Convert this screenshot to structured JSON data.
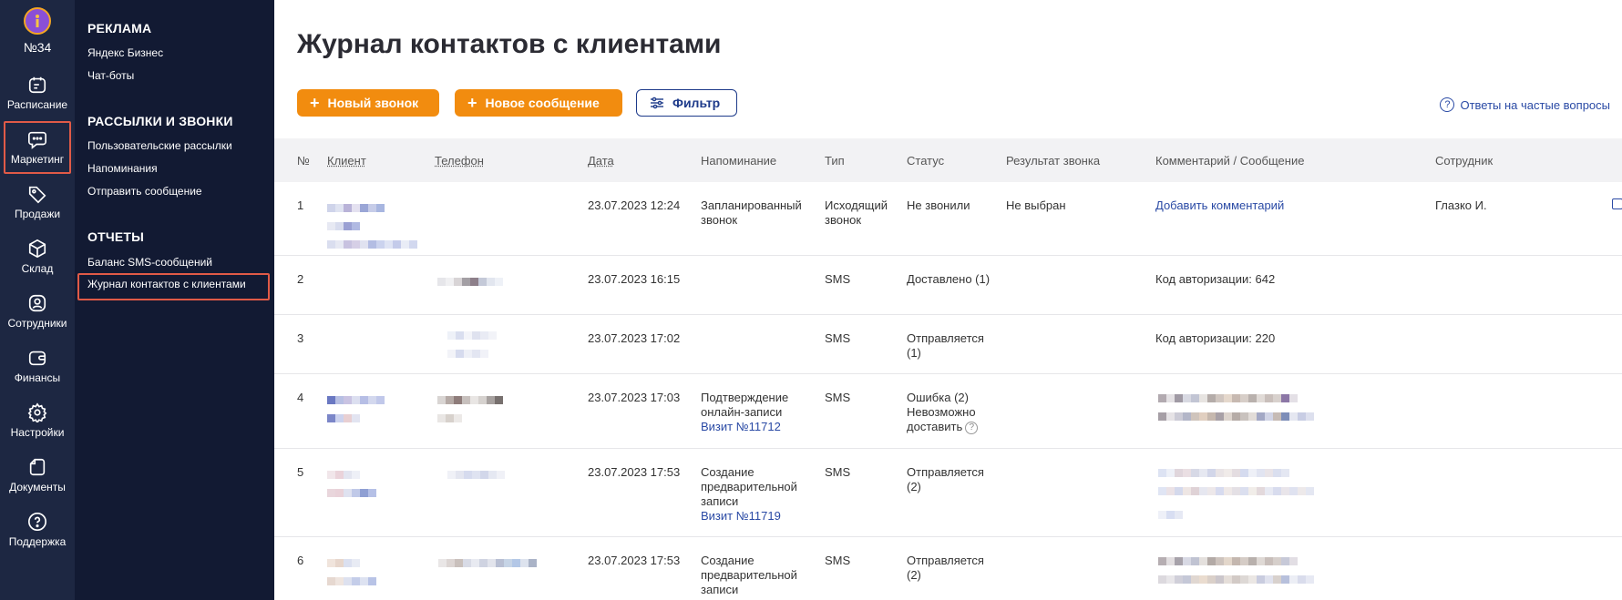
{
  "org": {
    "number": "№34"
  },
  "rail": {
    "items": [
      {
        "label": "Расписание",
        "icon": "calendar-icon"
      },
      {
        "label": "Маркетинг",
        "icon": "chat-icon"
      },
      {
        "label": "Продажи",
        "icon": "tag-icon"
      },
      {
        "label": "Склад",
        "icon": "box-icon"
      },
      {
        "label": "Сотрудники",
        "icon": "user-icon"
      },
      {
        "label": "Финансы",
        "icon": "wallet-icon"
      },
      {
        "label": "Настройки",
        "icon": "gear-icon"
      },
      {
        "label": "Документы",
        "icon": "document-icon"
      },
      {
        "label": "Поддержка",
        "icon": "help-icon"
      }
    ]
  },
  "subnav": {
    "sections": [
      {
        "title": "РЕКЛАМА",
        "links": [
          "Яндекс Бизнес",
          "Чат-боты"
        ]
      },
      {
        "title": "РАССЫЛКИ И ЗВОНКИ",
        "links": [
          "Пользовательские рассылки",
          "Напоминания",
          "Отправить сообщение"
        ]
      },
      {
        "title": "ОТЧЕТЫ",
        "links": [
          "Баланс SMS-сообщений",
          "Журнал контактов с клиентами"
        ]
      }
    ]
  },
  "page": {
    "title": "Журнал контактов с клиентами",
    "buttons": {
      "new_call": "Новый звонок",
      "new_message": "Новое сообщение",
      "filter": "Фильтр"
    },
    "faq": "Ответы на частые вопросы"
  },
  "table": {
    "headers": [
      "№",
      "Клиент",
      "Телефон",
      "Дата",
      "Напоминание",
      "Тип",
      "Статус",
      "Результат звонка",
      "Комментарий / Сообщение",
      "Сотрудник"
    ],
    "rows": [
      {
        "n": "1",
        "date": "23.07.2023 12:24",
        "reminder": "Запланированный звонок",
        "visit": "",
        "type": "Исходящий звонок",
        "status": "Не звонили",
        "result": "Не выбран",
        "comment": "Добавить комментарий",
        "employee": "Глазко И."
      },
      {
        "n": "2",
        "date": "23.07.2023 16:15",
        "reminder": "",
        "visit": "",
        "type": "SMS",
        "status": "Доставлено (1)",
        "result": "",
        "comment": "Код авторизации: 642",
        "employee": ""
      },
      {
        "n": "3",
        "date": "23.07.2023 17:02",
        "reminder": "",
        "visit": "",
        "type": "SMS",
        "status": "Отправляется (1)",
        "result": "",
        "comment": "Код авторизации: 220",
        "employee": ""
      },
      {
        "n": "4",
        "date": "23.07.2023 17:03",
        "reminder": "Подтверждение онлайн-записи",
        "visit": "Визит №11712",
        "type": "SMS",
        "status": "Ошибка (2) Невозможно доставить",
        "result": "",
        "comment": "",
        "employee": ""
      },
      {
        "n": "5",
        "date": "23.07.2023 17:53",
        "reminder": "Создание предварительной записи",
        "visit": "Визит №11719",
        "type": "SMS",
        "status": "Отправляется (2)",
        "result": "",
        "comment": "",
        "employee": ""
      },
      {
        "n": "6",
        "date": "23.07.2023 17:53",
        "reminder": "Создание предварительной записи",
        "visit": "",
        "type": "SMS",
        "status": "Отправляется (2)",
        "result": "",
        "comment": "",
        "employee": ""
      }
    ]
  },
  "colors": {
    "rail": "#1d2742",
    "subnav": "#121a33",
    "accent": "#f28c0f",
    "link": "#2a4aa5",
    "highlight": "#e05a47"
  }
}
